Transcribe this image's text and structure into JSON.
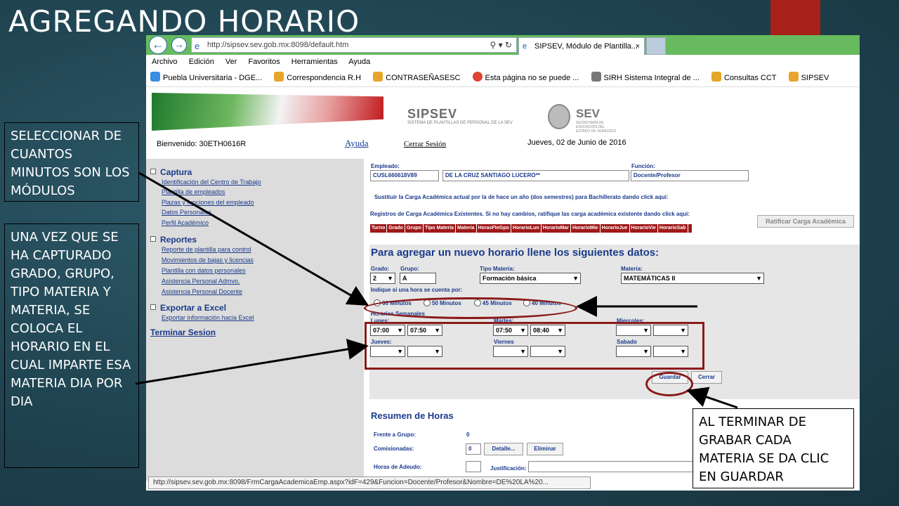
{
  "slide": {
    "title": "AGREGANDO HORARIO",
    "callout_minutes": "SELECCIONAR DE CUANTOS MINUTOS SON LOS MÓDULOS",
    "callout_schedule": "UNA VEZ QUE SE HA CAPTURADO GRADO, GRUPO, TIPO MATERIA Y MATERIA, SE COLOCA EL HORARIO EN EL CUAL IMPARTE ESA MATERIA DIA POR DIA",
    "callout_save": "AL TERMINAR DE GRABAR CADA MATERIA SE DA CLIC EN GUARDAR"
  },
  "browser": {
    "url": "http://sipsev.sev.gob.mx:8098/default.htm",
    "tab_title": "SIPSEV, Módulo de Plantilla...",
    "menu": [
      "Archivo",
      "Edición",
      "Ver",
      "Favoritos",
      "Herramientas",
      "Ayuda"
    ],
    "favorites": [
      "Puebla Universitaria - DGE...",
      "Correspondencia R.H",
      "CONTRASEÑASESC",
      "Esta página no se puede ...",
      "SIRH  Sistema Integral de ...",
      "Consultas CCT",
      "SIPSEV"
    ],
    "status_url": "http://sipsev.sev.gob.mx:8098/FrmCargaAcademicaEmp.aspx?idF=429&Funcion=Docente/Profesor&Nombre=DE%20LA%20..."
  },
  "header": {
    "brand": "SIPSEV",
    "brand_sub": "SISTEMA DE PLANTILLAS DE PERSONAL DE LA SEV",
    "sev": "SEV",
    "sev_sub": "SECRETARÍA DE EDUCACIÓN DEL ESTADO DE VERACRUZ",
    "welcome": "Bienvenido:  30ETH0616R",
    "ayuda": "Ayuda",
    "cerrar": "Cerrar Sesión",
    "fecha": "Jueves, 02 de Junio de 2016"
  },
  "sidebar": {
    "captura": "Captura",
    "captura_links": [
      "Identificación del Centro de Trabajo",
      "Plantilla de empleados",
      "Plazas y funciones del empleado",
      "Datos Personales",
      "Perfil Académico"
    ],
    "reportes": "Reportes",
    "reportes_links": [
      "Reporte de plantilla para control",
      "Movimientos de bajas y licencias",
      "Plantilla con datos personales",
      "Asistencia Personal Admvo.",
      "Asistencia Personal Docente"
    ],
    "exportar": "Exportar a Excel",
    "exportar_links": [
      "Exportar información hacia Excel"
    ],
    "terminar": "Terminar Sesion"
  },
  "empleado": {
    "label_empleado": "Empleado:",
    "rfc": "CUSL660618V89",
    "nombre": "DE LA CRUZ SANTIAGO LUCERO**",
    "label_funcion": "Función:",
    "funcion": "Docente/Profesor",
    "sustituir": "Sustituir la Carga Académica actual por la de hace un año (dos semestres) para Bachillerato dando click aqui:",
    "registros": "Registros de Carga Académica Existentes. Si no hay cambios, ratifique las carga académica existente dando click aqui:",
    "ratificar": "Ratificar Carga Académica",
    "columns": [
      "Turno",
      "Grado",
      "Grupo",
      "Tipo Materia",
      "Materia",
      "HorasFteGpo",
      "HorarioLun",
      "HorarioMar",
      "HorarioMie",
      "HorarioJue",
      "HorarioVie",
      "HorarioSab"
    ]
  },
  "form": {
    "title": "Para agregar un nuevo horario llene los siguientes datos:",
    "grado_label": "Grado:",
    "grado": "2",
    "grupo_label": "Grupo:",
    "grupo": "A",
    "tipo_label": "Tipo Materia:",
    "tipo": "Formación básica",
    "materia_label": "Materia:",
    "materia": "MATEMÁTICAS II",
    "indique": "Indique si una hora se cuenta por:",
    "options": [
      "60 Minutos",
      "50 Minutos",
      "45 Minutos",
      "40 Minutos"
    ],
    "horarios_label": "Horarios Semanales",
    "days": {
      "lunes": {
        "label": "Lunes:",
        "start": "07:00",
        "end": "07:50"
      },
      "martes": {
        "label": "Martes:",
        "start": "07:50",
        "end": "08:40"
      },
      "miercoles": {
        "label": "Miercoles:",
        "start": "",
        "end": ""
      },
      "jueves": {
        "label": "Jueves:",
        "start": "",
        "end": ""
      },
      "viernes": {
        "label": "Viernes",
        "start": "",
        "end": ""
      },
      "sabado": {
        "label": "Sabado",
        "start": "",
        "end": ""
      }
    },
    "guardar": "Guardar",
    "cerrar": "Cerrar"
  },
  "resumen": {
    "title": "Resumen de Horas",
    "frente_label": "Frente a Grupo:",
    "frente": "0",
    "comisionadas_label": "Comisionadas:",
    "comisionadas": "0",
    "detalle": "Detalle...",
    "eliminar": "Eliminar",
    "adeudo_label": "Horas de Adeudo:",
    "justificacion": "Justificación:"
  }
}
